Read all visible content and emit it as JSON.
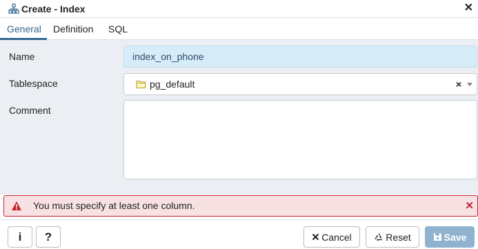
{
  "dialog": {
    "title": "Create - Index",
    "close_glyph": "✕"
  },
  "tabs": [
    {
      "label": "General",
      "active": true
    },
    {
      "label": "Definition",
      "active": false
    },
    {
      "label": "SQL",
      "active": false
    }
  ],
  "form": {
    "name_label": "Name",
    "name_value": "index_on_phone",
    "tablespace_label": "Tablespace",
    "tablespace_value": "pg_default",
    "tablespace_clear": "×",
    "comment_label": "Comment",
    "comment_value": ""
  },
  "alert": {
    "message": "You must specify at least one column.",
    "close_glyph": "✕"
  },
  "footer": {
    "info_label": "i",
    "help_label": "?",
    "cancel_label": "Cancel",
    "reset_label": "Reset",
    "save_label": "Save"
  },
  "icons": {
    "title": "hierarchy-icon",
    "tablespace": "folder-icon",
    "alert": "warning-icon",
    "cancel": "close-icon",
    "reset": "recycle-icon",
    "save": "save-icon"
  },
  "colors": {
    "accent": "#326690",
    "form_bg": "#ebeef3",
    "name_input_bg": "#d6ecf9",
    "alert_bg": "#f7e1e3",
    "alert_border": "#c5242d",
    "save_button": "#8fb3ce"
  }
}
